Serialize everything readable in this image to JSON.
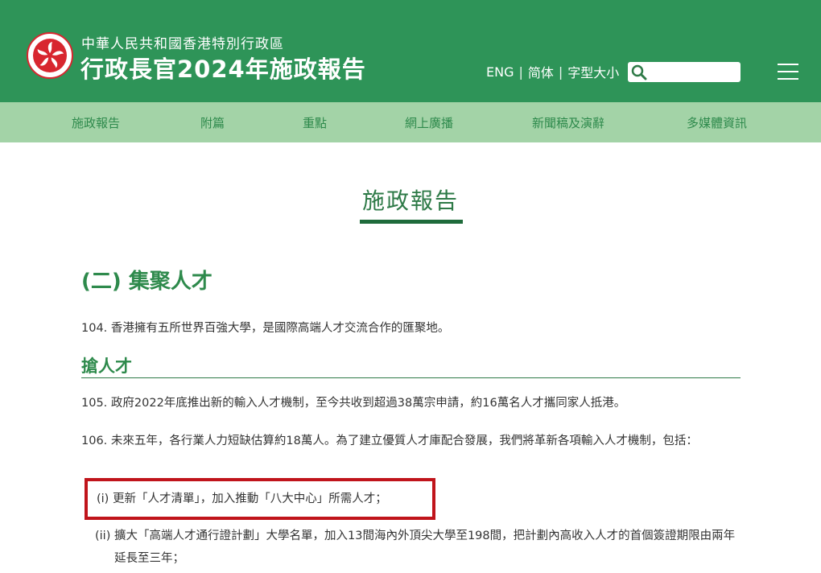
{
  "header": {
    "gov_line": "中華人民共和國香港特別行政區",
    "title": "行政長官2024年施政報告",
    "lang_eng": "ENG",
    "lang_sc": "简体",
    "font_size": "字型大小",
    "search_placeholder": ""
  },
  "nav": {
    "items": [
      "施政報告",
      "附篇",
      "重點",
      "網上廣播",
      "新聞稿及演辭",
      "多媒體資訊"
    ]
  },
  "main": {
    "page_heading": "施政報告",
    "section_title": "(二) 集聚人才",
    "p104": "104. 香港擁有五所世界百強大學，是國際高端人才交流合作的匯聚地。",
    "subhead": "搶人才",
    "p105": "105. 政府2022年底推出新的輸入人才機制，至今共收到超過38萬宗申請，約16萬名人才攜同家人抵港。",
    "p106": "106. 未來五年，各行業人力短缺估算約18萬人。為了建立優質人才庫配合發展，我們將革新各項輸入人才機制，包括：",
    "item_i": "(i)  更新「人才清單」，加入推動「八大中心」所需人才；",
    "item_ii_num": "(ii)",
    "item_ii": "擴大「高端人才通行證計劃」大學名單，加入13間海內外頂尖大學至198間，把計劃內高收入人才的首個簽證期限由兩年延長至三年；"
  },
  "colors": {
    "header_green": "#2e9458",
    "nav_green": "#a3d3a7",
    "accent_green": "#2e8a4c",
    "highlight_red": "#c0141b"
  }
}
